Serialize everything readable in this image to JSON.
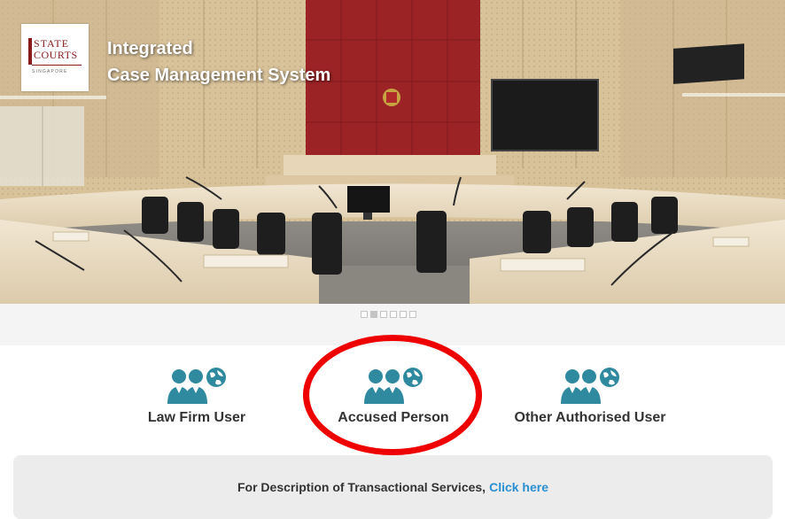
{
  "hero": {
    "logo": {
      "line1": "STATE",
      "line2": "COURTS",
      "line3": "SINGAPORE"
    },
    "title_line1": "Integrated",
    "title_line2": "Case Management System"
  },
  "carousel": {
    "dot_count": 6,
    "active_index": 1
  },
  "options": [
    {
      "label": "Law Firm User",
      "icon": "users-globe-icon"
    },
    {
      "label": "Accused Person",
      "icon": "users-globe-icon",
      "highlighted": true
    },
    {
      "label": "Other Authorised User",
      "icon": "users-globe-icon"
    }
  ],
  "info": {
    "text": "For Description of Transactional Services,",
    "link_label": "Click here"
  },
  "colors": {
    "icon_teal": "#2f8a9f",
    "link": "#2a8fd1",
    "highlight": "#ee0000",
    "logo_maroon": "#8a1b1b"
  }
}
